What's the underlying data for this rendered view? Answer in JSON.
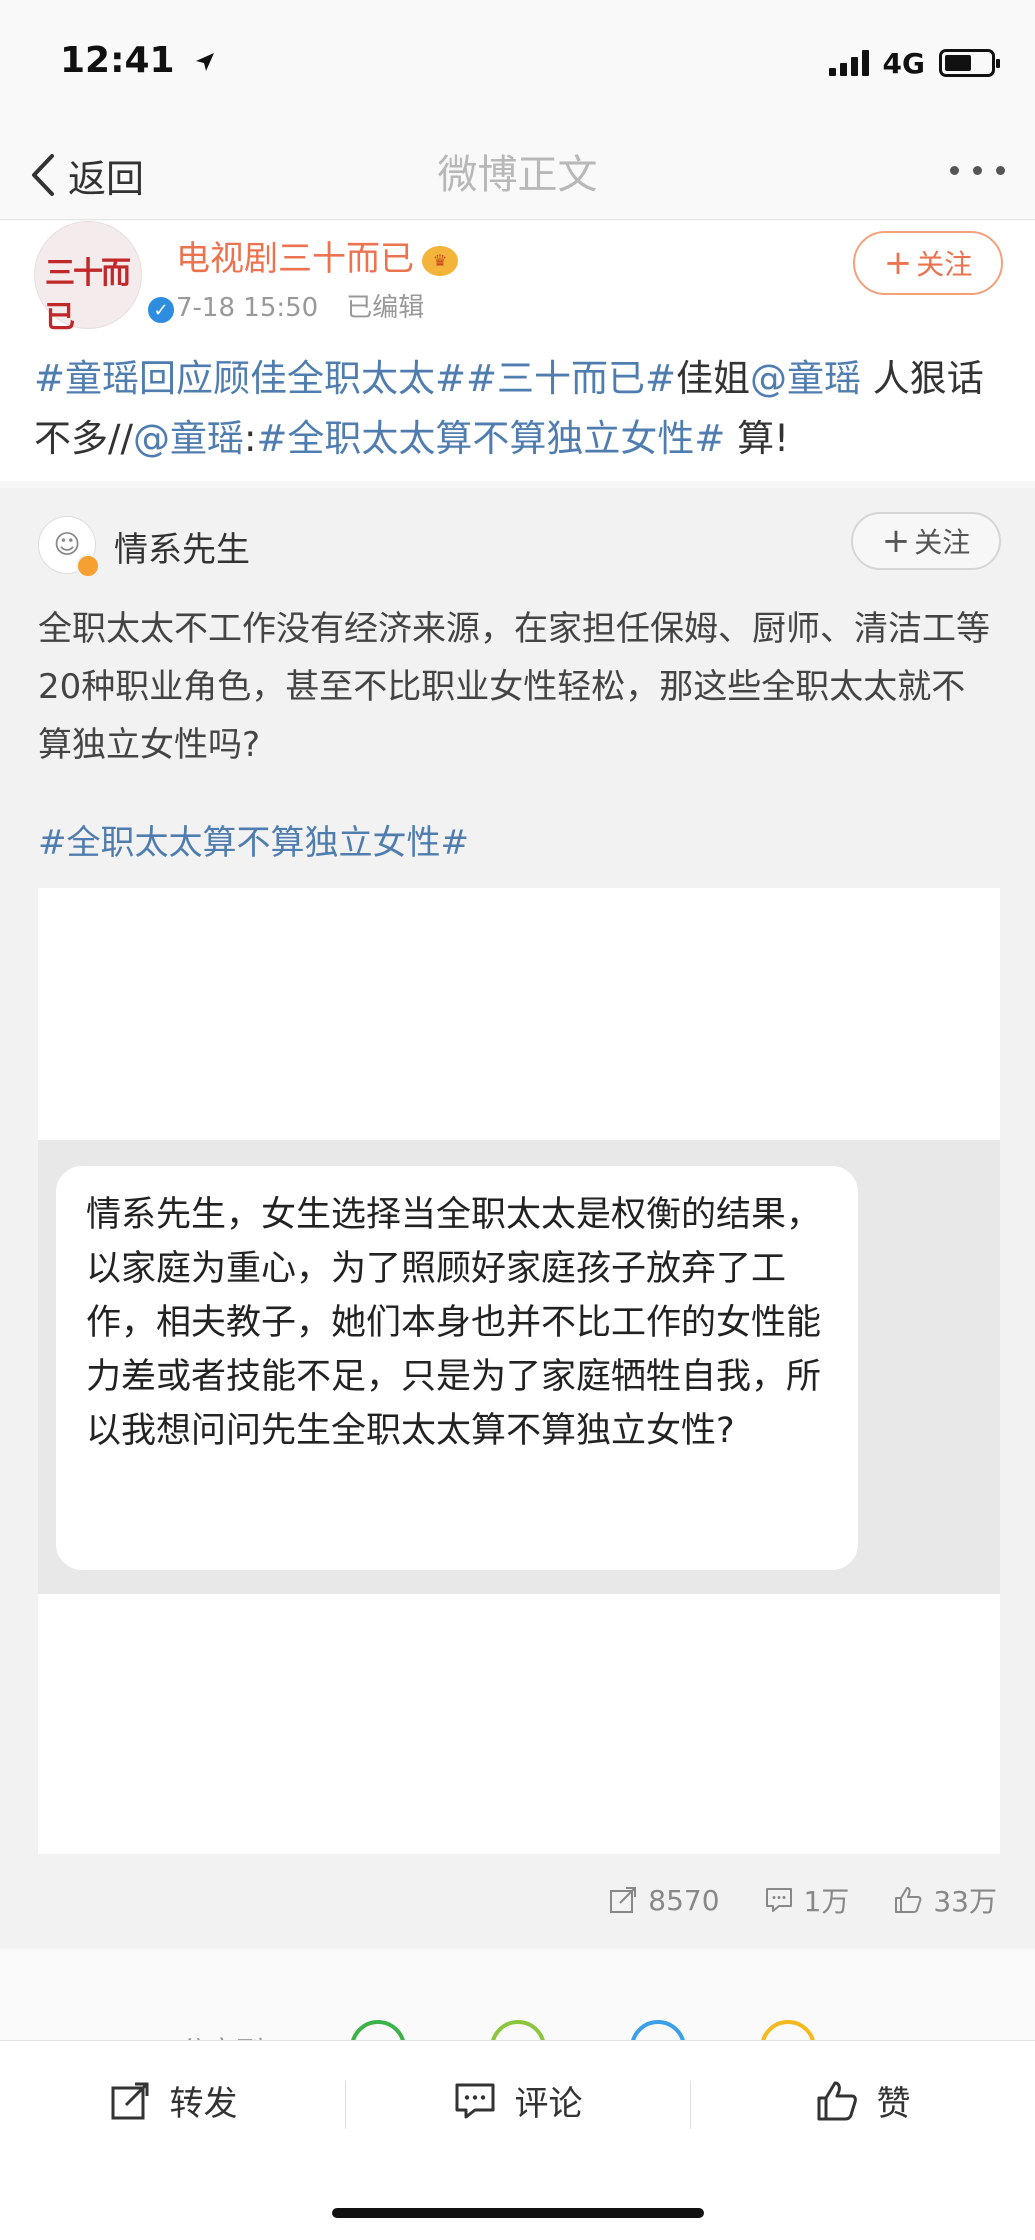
{
  "status": {
    "time": "12:41",
    "network": "4G",
    "battery_level": 0.6
  },
  "nav": {
    "back_label": "返回",
    "title": "微博正文"
  },
  "post": {
    "author": "电视剧三十而已",
    "time": "7-18 15:50",
    "edited": "已编辑",
    "follow_label": "关注",
    "text": {
      "tag1": "#童瑶回应顾佳全职太太#",
      "tag2": "#三十而已#",
      "plain1": "佳姐",
      "mention1": "@童瑶",
      "plain2": " 人狠话不多//",
      "mention2": "@童瑶",
      "colon": ":",
      "tag3": "#全职太太算不算独立女性#",
      "plain3": " 算!"
    }
  },
  "repost": {
    "author": "情系先生",
    "follow_label": "关注",
    "text": "全职太太不工作没有经济来源，在家担任保姆、厨师、清洁工等20种职业角色，甚至不比职业女性轻松，那这些全职太太就不算独立女性吗?",
    "tag": "#全职太太算不算独立女性#",
    "image_bubble_text": "情系先生，女生选择当全职太太是权衡的结果，以家庭为重心，为了照顾好家庭孩子放弃了工作，相夫教子，她们本身也并不比工作的女性能力差或者技能不足，只是为了家庭牺牲自我，所以我想问问先生全职太太算不算独立女性?",
    "stats": {
      "reposts": "8570",
      "comments": "1万",
      "likes": "33万"
    }
  },
  "share_row": {
    "label": "分享到"
  },
  "actions": {
    "repost": "转发",
    "comment": "评论",
    "like": "赞"
  }
}
